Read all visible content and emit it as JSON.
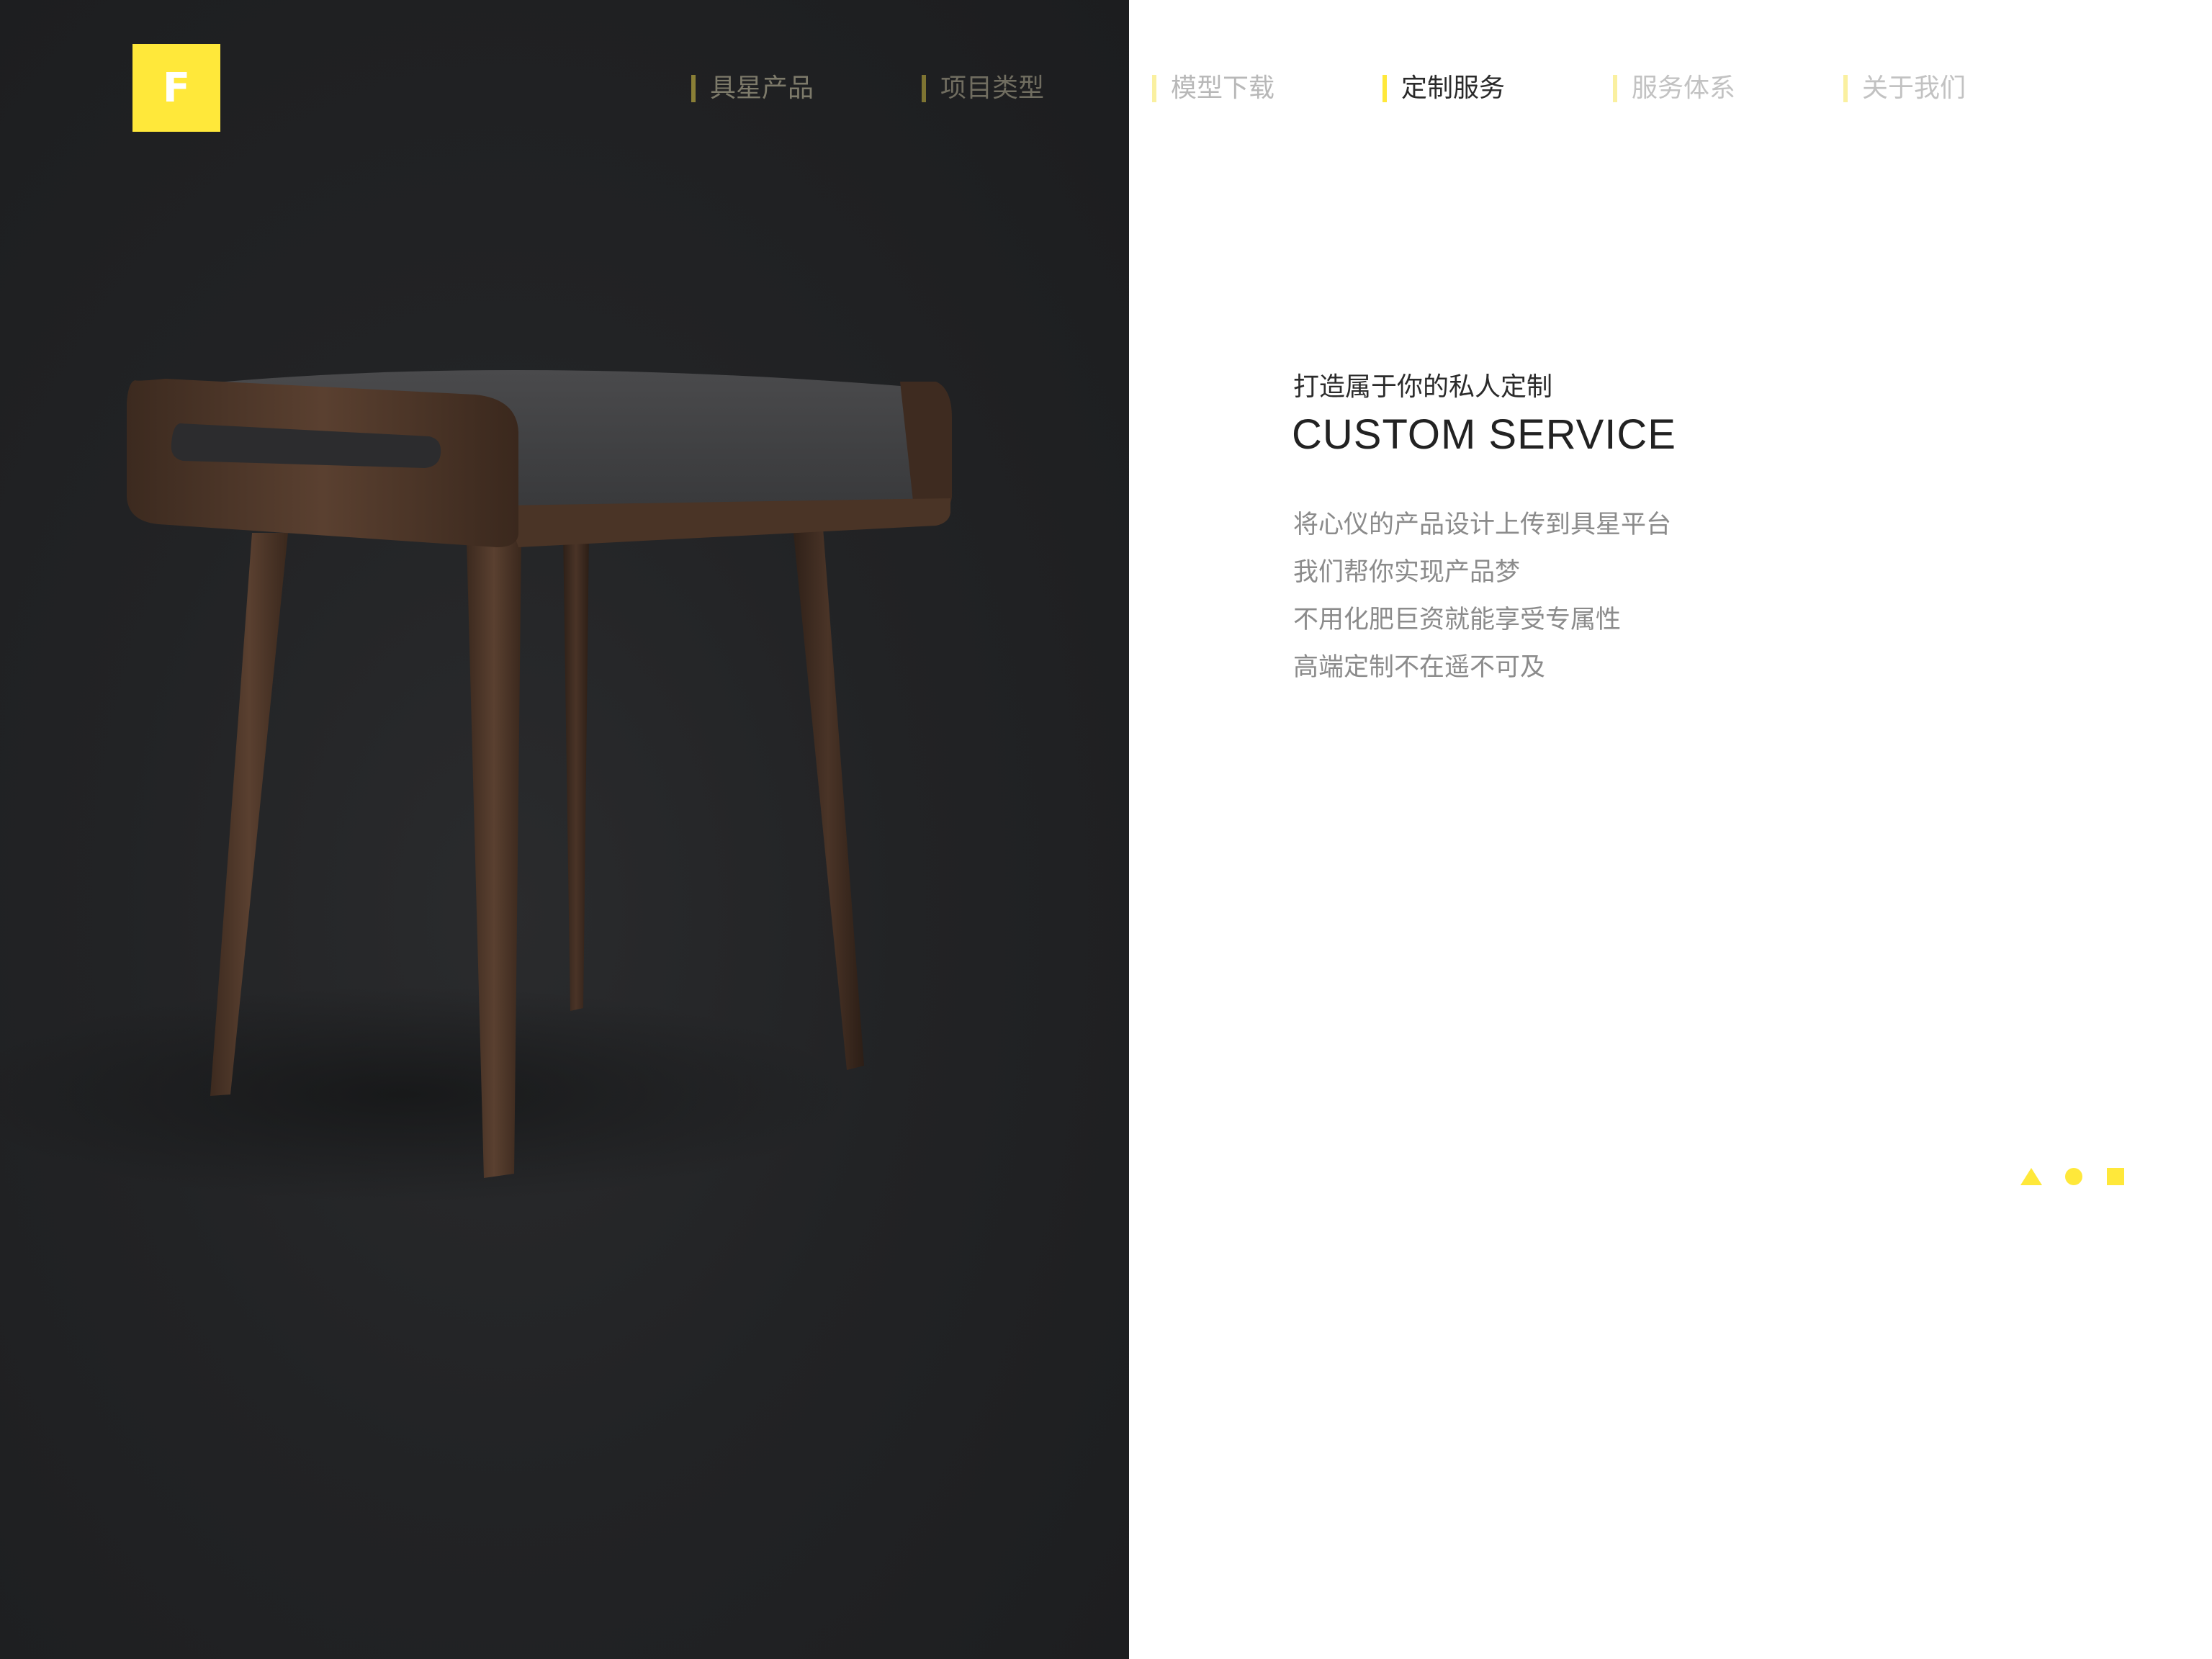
{
  "logo": {
    "letter": "F",
    "color": "#ffe83a"
  },
  "nav": {
    "items": [
      {
        "label": "具星产品",
        "text_color": "#7d7a6a",
        "bar_color": "#8a7f36"
      },
      {
        "label": "项目类型",
        "text_color": "#706d60",
        "bar_color": "#7e7432"
      },
      {
        "label": "模型下载",
        "text_color": "#b8b8b8",
        "bar_color": "#faf0a0"
      },
      {
        "label": "定制服务",
        "text_color": "#2a2a2a",
        "bar_color": "#ffe83a"
      },
      {
        "label": "服务体系",
        "text_color": "#c2c2c2",
        "bar_color": "#faf0a0"
      },
      {
        "label": "关于我们",
        "text_color": "#c2c2c2",
        "bar_color": "#faf0a0"
      }
    ]
  },
  "hero": {
    "subtitle": "打造属于你的私人定制",
    "title": "CUSTOM SERVICE",
    "description": [
      "将心仪的产品设计上传到具星平台",
      "我们帮你实现产品梦",
      "不用化肥巨资就能享受专属性",
      "高端定制不在遥不可及"
    ]
  },
  "decorations": {
    "shapes": [
      "triangle",
      "circle",
      "square"
    ],
    "color": "#ffe83a"
  },
  "colors": {
    "dark_background": "#222325",
    "accent": "#ffe83a"
  }
}
